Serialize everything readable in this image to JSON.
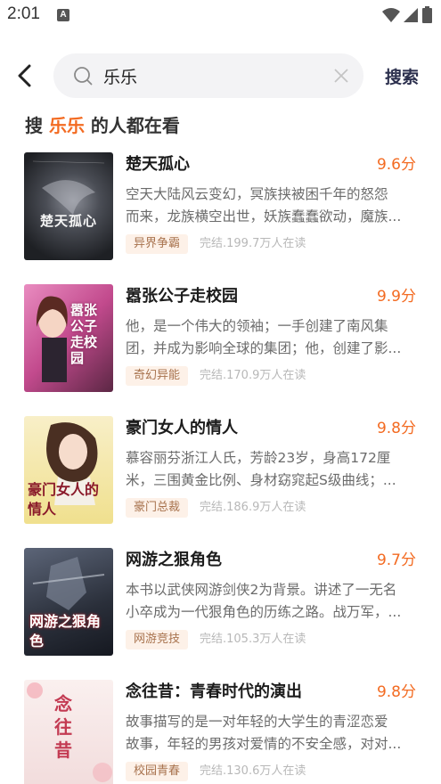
{
  "status_bar": {
    "time": "2:01",
    "notif_letter": "A"
  },
  "search": {
    "value": "乐乐",
    "button_label": "搜索"
  },
  "section": {
    "prefix": "搜 ",
    "keyword": "乐乐",
    "suffix": " 的人都在看"
  },
  "books": [
    {
      "title": "楚天孤心",
      "score": "9.6分",
      "desc_lines": [
        "空天大陆风云变幻，冥族挟被困千年的怒怨",
        "而来，龙族横空出世，妖族蠢蠢欲动，魔族..."
      ],
      "tag": "异界争霸",
      "meta": "完结.199.7万人在读",
      "cover_text": "楚天孤心",
      "cover_bg": "#2b2d33"
    },
    {
      "title": "嚣张公子走校园",
      "score": "9.9分",
      "desc_lines": [
        "他，是一个伟大的领袖；一手创建了南风集",
        "团，并成为影响全球的集团；他，创建了影..."
      ],
      "tag": "奇幻异能",
      "meta": "完结.170.9万人在读",
      "cover_text": "嚣张公子走校园",
      "cover_bg": "#d96aa9"
    },
    {
      "title": "豪门女人的情人",
      "score": "9.8分",
      "desc_lines": [
        "慕容丽芬浙江人氏，芳龄23岁，身高172厘",
        "米，三围黄金比例、身材窈窕起S级曲线；..."
      ],
      "tag": "豪门总裁",
      "meta": "完结.186.9万人在读",
      "cover_text": "豪门女人的情人",
      "cover_bg": "#f3e6a7"
    },
    {
      "title": "网游之狠角色",
      "score": "9.7分",
      "desc_lines": [
        "本书以武侠网游剑侠2为背景。讲述了一无名",
        "小卒成为一代狠角色的历练之路。战万军，..."
      ],
      "tag": "网游竞技",
      "meta": "完结.105.3万人在读",
      "cover_text": "网游之狠角色",
      "cover_bg": "#3a4150"
    },
    {
      "title": "念往昔：青春时代的演出",
      "score": "9.8分",
      "desc_lines": [
        "故事描写的是一对年轻的大学生的青涩恋爱",
        "故事，年轻的男孩对爱情的不安全感，对对..."
      ],
      "tag": "校园青春",
      "meta": "完结.130.6万人在读",
      "cover_text": "念往昔",
      "cover_bg": "#f4e4e4"
    }
  ],
  "colors": {
    "accent": "#f36b22",
    "tag_bg": "#fdf1e8",
    "tag_text": "#a8734e"
  }
}
